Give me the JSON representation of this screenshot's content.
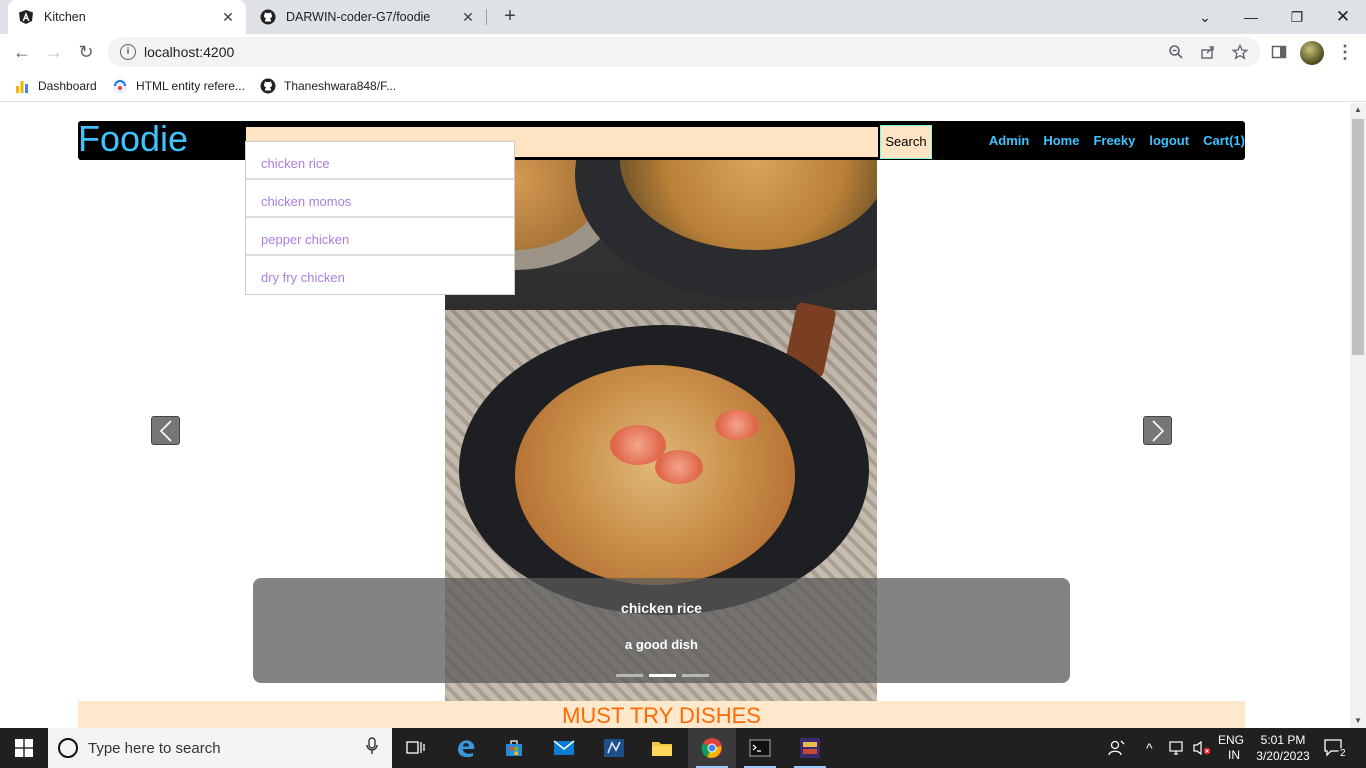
{
  "browser": {
    "tabs": [
      {
        "title": "Kitchen",
        "icon": "angular-icon",
        "active": true
      },
      {
        "title": "DARWIN-coder-G7/foodie",
        "icon": "github-icon",
        "active": false
      }
    ],
    "url": "localhost:4200",
    "bookmarks": [
      {
        "label": "Dashboard",
        "icon": "dashboard-icon"
      },
      {
        "label": "HTML entity refere...",
        "icon": "html-entity-icon"
      },
      {
        "label": "Thaneshwara848/F...",
        "icon": "github-icon"
      }
    ]
  },
  "app": {
    "brand": "Foodie",
    "search": {
      "value": "",
      "button_label": "Search"
    },
    "nav_links": [
      "Admin",
      "Home",
      "Freeky",
      "logout",
      "Cart(1)"
    ],
    "suggestions": [
      "chicken rice",
      "chicken momos",
      "pepper chicken",
      "dry fry chicken"
    ],
    "carousel": {
      "caption_title": "chicken rice",
      "caption_subtitle": "a good dish",
      "indicators": 3,
      "active_index": 1
    },
    "section_title": "MUST TRY DISHES",
    "colors": {
      "brand": "#3ec3ff",
      "accent": "#ff6a00",
      "search_bg": "#ffe4c4"
    }
  },
  "taskbar": {
    "search_placeholder": "Type here to search",
    "language": "ENG",
    "region": "IN",
    "time": "5:01 PM",
    "date": "3/20/2023",
    "notifications": "2"
  }
}
